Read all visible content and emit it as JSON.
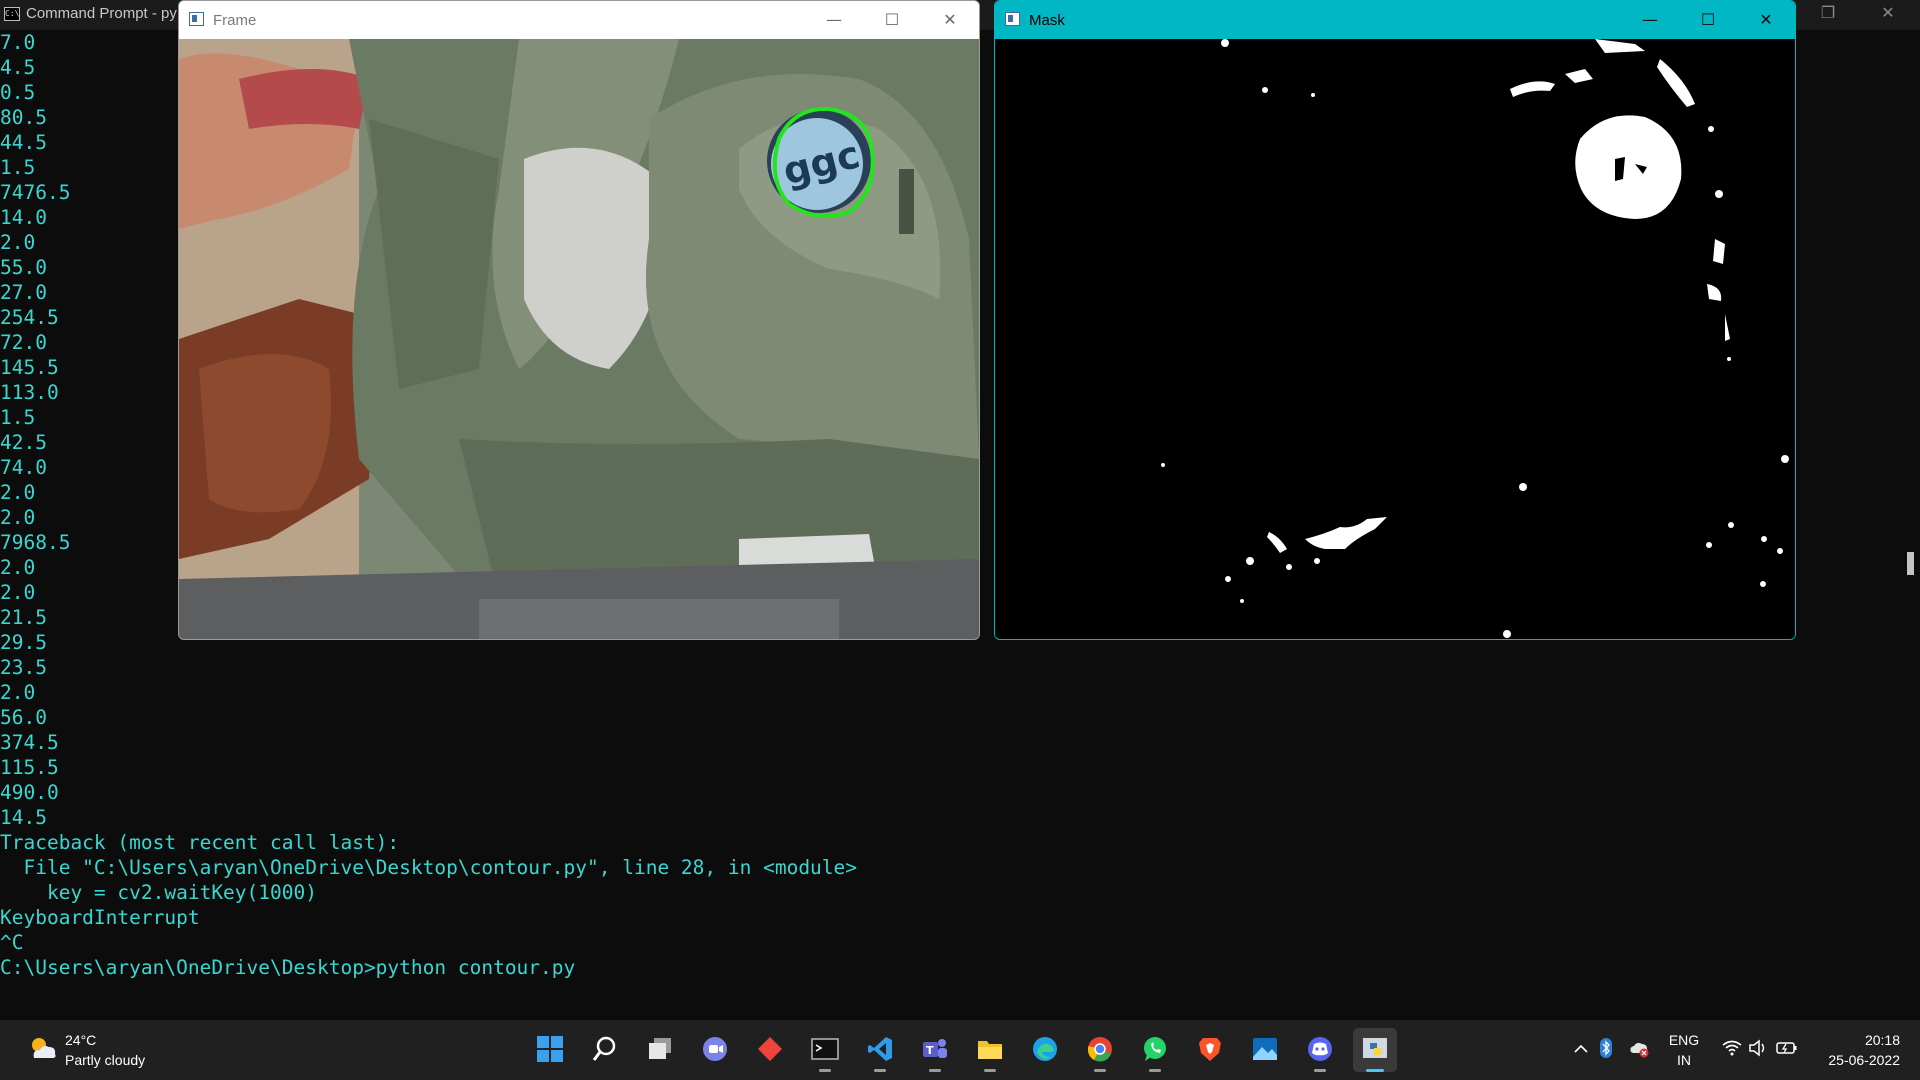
{
  "cmd": {
    "title": "Command Prompt - py",
    "lines": [
      "7.0",
      "4.5",
      "0.5",
      "80.5",
      "44.5",
      "1.5",
      "7476.5",
      "14.0",
      "2.0",
      "55.0",
      "27.0",
      "254.5",
      "72.0",
      "145.5",
      "113.0",
      "1.5",
      "42.5",
      "74.0",
      "2.0",
      "2.0",
      "7968.5",
      "2.0",
      "2.0",
      "21.5",
      "29.5",
      "23.5",
      "2.0",
      "56.0",
      "374.5",
      "115.5",
      "490.0",
      "14.5",
      "Traceback (most recent call last):",
      "  File \"C:\\Users\\aryan\\OneDrive\\Desktop\\contour.py\", line 28, in <module>",
      "    key = cv2.waitKey(1000)",
      "KeyboardInterrupt",
      "^C",
      "C:\\Users\\aryan\\OneDrive\\Desktop>python contour.py"
    ],
    "text_color": "#3ad7d1"
  },
  "frame_window": {
    "title": "Frame"
  },
  "mask_window": {
    "title": "Mask",
    "accent": "#00b7c3"
  },
  "taskbar": {
    "weather": {
      "temp": "24°C",
      "condition": "Partly cloudy"
    },
    "apps": [
      "start-icon",
      "search-icon",
      "task-view-icon",
      "chat-icon",
      "anydesk-icon",
      "terminal-icon",
      "vscode-icon",
      "teams-icon",
      "file-explorer-icon",
      "edge-icon",
      "chrome-icon",
      "whatsapp-icon",
      "brave-icon",
      "photos-icon",
      "discord-icon",
      "python-icon"
    ],
    "lang": {
      "line1": "ENG",
      "line2": "IN"
    },
    "clock": {
      "time": "20:18",
      "date": "25-06-2022"
    }
  }
}
